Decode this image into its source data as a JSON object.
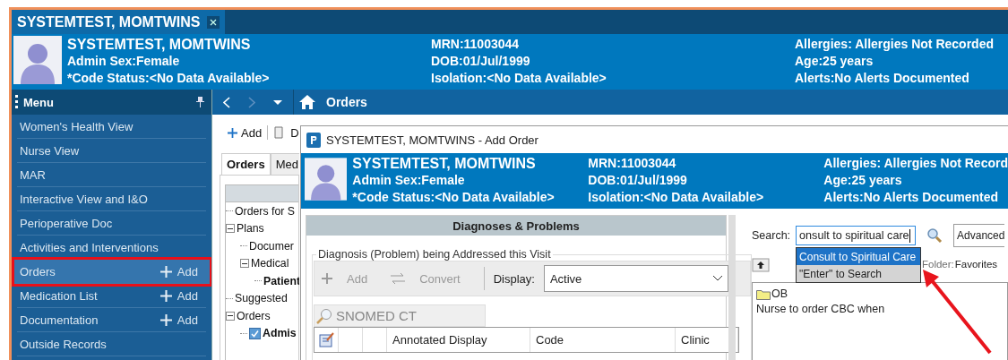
{
  "patient_tab": {
    "label": "SYSTEMTEST, MOMTWINS",
    "selected": true
  },
  "banner": {
    "name": "SYSTEMTEST, MOMTWINS",
    "sex": "Admin Sex:Female",
    "code_status": "*Code Status:<No Data Available>",
    "mrn": "MRN:11003044",
    "dob": "DOB:01/Jul/1999",
    "isolation": "Isolation:<No Data Available>",
    "allergies": "Allergies: Allergies Not Recorded",
    "age": "Age:25 years",
    "alerts": "Alerts:No Alerts Documented"
  },
  "menu": {
    "title": "Menu",
    "items": [
      {
        "label": "Women's Health View",
        "selected": false
      },
      {
        "label": "Nurse View",
        "selected": false
      },
      {
        "label": "MAR",
        "selected": false
      },
      {
        "label": "Interactive View and I&O",
        "selected": false
      },
      {
        "label": "Perioperative Doc",
        "selected": false
      },
      {
        "label": "Activities and Interventions",
        "selected": false
      },
      {
        "label": "Orders",
        "add": "Add",
        "selected": true
      },
      {
        "label": "Medication List",
        "add": "Add",
        "selected": false
      },
      {
        "label": "Documentation",
        "add": "Add",
        "selected": false
      },
      {
        "label": "Outside Records",
        "selected": false
      }
    ]
  },
  "navbar": {
    "title": "Orders"
  },
  "orders": {
    "toolbar": {
      "add": "Add",
      "column_2": "D"
    },
    "tabs": [
      {
        "label": "Orders",
        "selected": true
      },
      {
        "label": "Med",
        "selected": false
      }
    ],
    "tree": [
      {
        "label": "Orders for S"
      },
      {
        "label": "Plans",
        "expanded": true,
        "children": [
          {
            "label": "Documer"
          },
          {
            "label": "Medical",
            "expanded": true,
            "children": [
              {
                "label": "Patient",
                "bold": true
              }
            ]
          }
        ]
      },
      {
        "label": "Suggested"
      },
      {
        "label": "Orders",
        "expanded": true,
        "children": [
          {
            "label": "Admis",
            "bold": true,
            "kind": "checkbox",
            "checked": true
          }
        ]
      }
    ]
  },
  "dialog": {
    "title": "SYSTEMTEST, MOMTWINS - Add Order",
    "banner": {
      "name": "SYSTEMTEST, MOMTWINS",
      "sex": "Admin Sex:Female",
      "code_status": "*Code Status:<No Data Available>",
      "mrn": "MRN:11003044",
      "dob": "DOB:01/Jul/1999",
      "isolation": "Isolation:<No Data Available>",
      "allergies": "Allergies: Allergies Not Record",
      "age": "Age:25 years",
      "alerts": "Alerts:No Alerts Documented"
    },
    "diagnoses": {
      "title": "Diagnoses & Problems",
      "group": "Diagnosis (Problem) being Addressed this Visit",
      "add": {
        "label": "Add",
        "disabled": true
      },
      "convert": {
        "label": "Convert",
        "disabled": true
      },
      "display_label": "Display:",
      "display_value": "Active",
      "search_tab": "SNOMED CT",
      "columns": [
        "Annotated Display",
        "Code",
        "Clinic"
      ]
    },
    "search": {
      "label": "Search:",
      "value": "onsult to spiritual care",
      "advanced": "Advanced",
      "suggestions": [
        {
          "label": "Consult to Spiritual Care",
          "selected": true
        },
        {
          "label": "\"Enter\" to Search",
          "selected": false
        }
      ],
      "folder_label": "Folder:",
      "folder": "Favorites"
    },
    "folder_items": [
      {
        "kind": "folder",
        "label": "OB"
      },
      {
        "kind": "text",
        "label": "Nurse to order CBC when"
      }
    ]
  }
}
